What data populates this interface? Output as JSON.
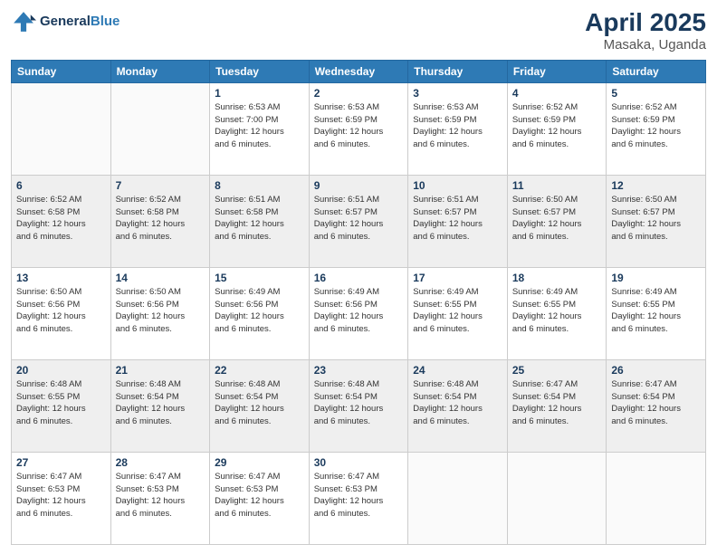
{
  "header": {
    "logo_line1": "General",
    "logo_line2": "Blue",
    "title": "April 2025",
    "location": "Masaka, Uganda"
  },
  "weekdays": [
    "Sunday",
    "Monday",
    "Tuesday",
    "Wednesday",
    "Thursday",
    "Friday",
    "Saturday"
  ],
  "rows": [
    [
      {
        "num": "",
        "sunrise": "",
        "sunset": "",
        "daylight": ""
      },
      {
        "num": "",
        "sunrise": "",
        "sunset": "",
        "daylight": ""
      },
      {
        "num": "1",
        "sunrise": "Sunrise: 6:53 AM",
        "sunset": "Sunset: 7:00 PM",
        "daylight": "Daylight: 12 hours and 6 minutes."
      },
      {
        "num": "2",
        "sunrise": "Sunrise: 6:53 AM",
        "sunset": "Sunset: 6:59 PM",
        "daylight": "Daylight: 12 hours and 6 minutes."
      },
      {
        "num": "3",
        "sunrise": "Sunrise: 6:53 AM",
        "sunset": "Sunset: 6:59 PM",
        "daylight": "Daylight: 12 hours and 6 minutes."
      },
      {
        "num": "4",
        "sunrise": "Sunrise: 6:52 AM",
        "sunset": "Sunset: 6:59 PM",
        "daylight": "Daylight: 12 hours and 6 minutes."
      },
      {
        "num": "5",
        "sunrise": "Sunrise: 6:52 AM",
        "sunset": "Sunset: 6:59 PM",
        "daylight": "Daylight: 12 hours and 6 minutes."
      }
    ],
    [
      {
        "num": "6",
        "sunrise": "Sunrise: 6:52 AM",
        "sunset": "Sunset: 6:58 PM",
        "daylight": "Daylight: 12 hours and 6 minutes."
      },
      {
        "num": "7",
        "sunrise": "Sunrise: 6:52 AM",
        "sunset": "Sunset: 6:58 PM",
        "daylight": "Daylight: 12 hours and 6 minutes."
      },
      {
        "num": "8",
        "sunrise": "Sunrise: 6:51 AM",
        "sunset": "Sunset: 6:58 PM",
        "daylight": "Daylight: 12 hours and 6 minutes."
      },
      {
        "num": "9",
        "sunrise": "Sunrise: 6:51 AM",
        "sunset": "Sunset: 6:57 PM",
        "daylight": "Daylight: 12 hours and 6 minutes."
      },
      {
        "num": "10",
        "sunrise": "Sunrise: 6:51 AM",
        "sunset": "Sunset: 6:57 PM",
        "daylight": "Daylight: 12 hours and 6 minutes."
      },
      {
        "num": "11",
        "sunrise": "Sunrise: 6:50 AM",
        "sunset": "Sunset: 6:57 PM",
        "daylight": "Daylight: 12 hours and 6 minutes."
      },
      {
        "num": "12",
        "sunrise": "Sunrise: 6:50 AM",
        "sunset": "Sunset: 6:57 PM",
        "daylight": "Daylight: 12 hours and 6 minutes."
      }
    ],
    [
      {
        "num": "13",
        "sunrise": "Sunrise: 6:50 AM",
        "sunset": "Sunset: 6:56 PM",
        "daylight": "Daylight: 12 hours and 6 minutes."
      },
      {
        "num": "14",
        "sunrise": "Sunrise: 6:50 AM",
        "sunset": "Sunset: 6:56 PM",
        "daylight": "Daylight: 12 hours and 6 minutes."
      },
      {
        "num": "15",
        "sunrise": "Sunrise: 6:49 AM",
        "sunset": "Sunset: 6:56 PM",
        "daylight": "Daylight: 12 hours and 6 minutes."
      },
      {
        "num": "16",
        "sunrise": "Sunrise: 6:49 AM",
        "sunset": "Sunset: 6:56 PM",
        "daylight": "Daylight: 12 hours and 6 minutes."
      },
      {
        "num": "17",
        "sunrise": "Sunrise: 6:49 AM",
        "sunset": "Sunset: 6:55 PM",
        "daylight": "Daylight: 12 hours and 6 minutes."
      },
      {
        "num": "18",
        "sunrise": "Sunrise: 6:49 AM",
        "sunset": "Sunset: 6:55 PM",
        "daylight": "Daylight: 12 hours and 6 minutes."
      },
      {
        "num": "19",
        "sunrise": "Sunrise: 6:49 AM",
        "sunset": "Sunset: 6:55 PM",
        "daylight": "Daylight: 12 hours and 6 minutes."
      }
    ],
    [
      {
        "num": "20",
        "sunrise": "Sunrise: 6:48 AM",
        "sunset": "Sunset: 6:55 PM",
        "daylight": "Daylight: 12 hours and 6 minutes."
      },
      {
        "num": "21",
        "sunrise": "Sunrise: 6:48 AM",
        "sunset": "Sunset: 6:54 PM",
        "daylight": "Daylight: 12 hours and 6 minutes."
      },
      {
        "num": "22",
        "sunrise": "Sunrise: 6:48 AM",
        "sunset": "Sunset: 6:54 PM",
        "daylight": "Daylight: 12 hours and 6 minutes."
      },
      {
        "num": "23",
        "sunrise": "Sunrise: 6:48 AM",
        "sunset": "Sunset: 6:54 PM",
        "daylight": "Daylight: 12 hours and 6 minutes."
      },
      {
        "num": "24",
        "sunrise": "Sunrise: 6:48 AM",
        "sunset": "Sunset: 6:54 PM",
        "daylight": "Daylight: 12 hours and 6 minutes."
      },
      {
        "num": "25",
        "sunrise": "Sunrise: 6:47 AM",
        "sunset": "Sunset: 6:54 PM",
        "daylight": "Daylight: 12 hours and 6 minutes."
      },
      {
        "num": "26",
        "sunrise": "Sunrise: 6:47 AM",
        "sunset": "Sunset: 6:54 PM",
        "daylight": "Daylight: 12 hours and 6 minutes."
      }
    ],
    [
      {
        "num": "27",
        "sunrise": "Sunrise: 6:47 AM",
        "sunset": "Sunset: 6:53 PM",
        "daylight": "Daylight: 12 hours and 6 minutes."
      },
      {
        "num": "28",
        "sunrise": "Sunrise: 6:47 AM",
        "sunset": "Sunset: 6:53 PM",
        "daylight": "Daylight: 12 hours and 6 minutes."
      },
      {
        "num": "29",
        "sunrise": "Sunrise: 6:47 AM",
        "sunset": "Sunset: 6:53 PM",
        "daylight": "Daylight: 12 hours and 6 minutes."
      },
      {
        "num": "30",
        "sunrise": "Sunrise: 6:47 AM",
        "sunset": "Sunset: 6:53 PM",
        "daylight": "Daylight: 12 hours and 6 minutes."
      },
      {
        "num": "",
        "sunrise": "",
        "sunset": "",
        "daylight": ""
      },
      {
        "num": "",
        "sunrise": "",
        "sunset": "",
        "daylight": ""
      },
      {
        "num": "",
        "sunrise": "",
        "sunset": "",
        "daylight": ""
      }
    ]
  ]
}
